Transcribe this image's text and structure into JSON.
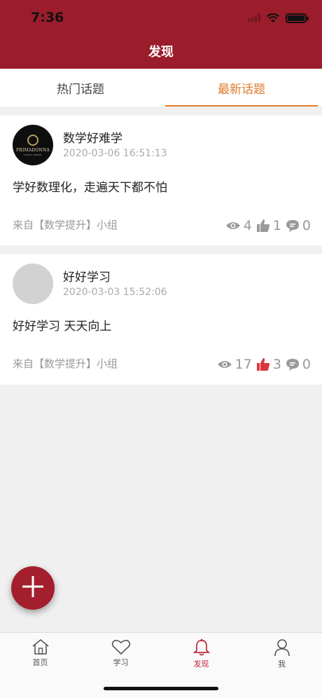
{
  "status": {
    "time": "7:36"
  },
  "nav": {
    "title": "发现"
  },
  "tabs": [
    {
      "label": "热门话题",
      "active": false
    },
    {
      "label": "最新话题",
      "active": true
    }
  ],
  "posts": [
    {
      "avatar_text": "PRIMADONNA",
      "avatar_subtext": "LUXURY APPAREL",
      "name": "数学好难学",
      "date": "2020-03-06 16:51:13",
      "content": "学好数理化，走遍天下都不怕",
      "group": "来自【数学提升】小组",
      "views": "4",
      "likes": "1",
      "comments": "0",
      "liked": false
    },
    {
      "name": "好好学习",
      "date": "2020-03-03 15:52:06",
      "content": "好好学习 天天向上",
      "group": "来自【数学提升】小组",
      "views": "17",
      "likes": "3",
      "comments": "0",
      "liked": true
    }
  ],
  "tabbar": [
    {
      "label": "首页",
      "icon": "home-icon",
      "active": false
    },
    {
      "label": "学习",
      "icon": "heart-icon",
      "active": false
    },
    {
      "label": "发现",
      "icon": "bell-icon",
      "active": true
    },
    {
      "label": "我",
      "icon": "user-icon",
      "active": false
    }
  ],
  "colors": {
    "brand": "#9b1c2b",
    "tab_active": "#e07b2c",
    "liked": "#d9363e",
    "tabbar_active": "#c0283a"
  }
}
